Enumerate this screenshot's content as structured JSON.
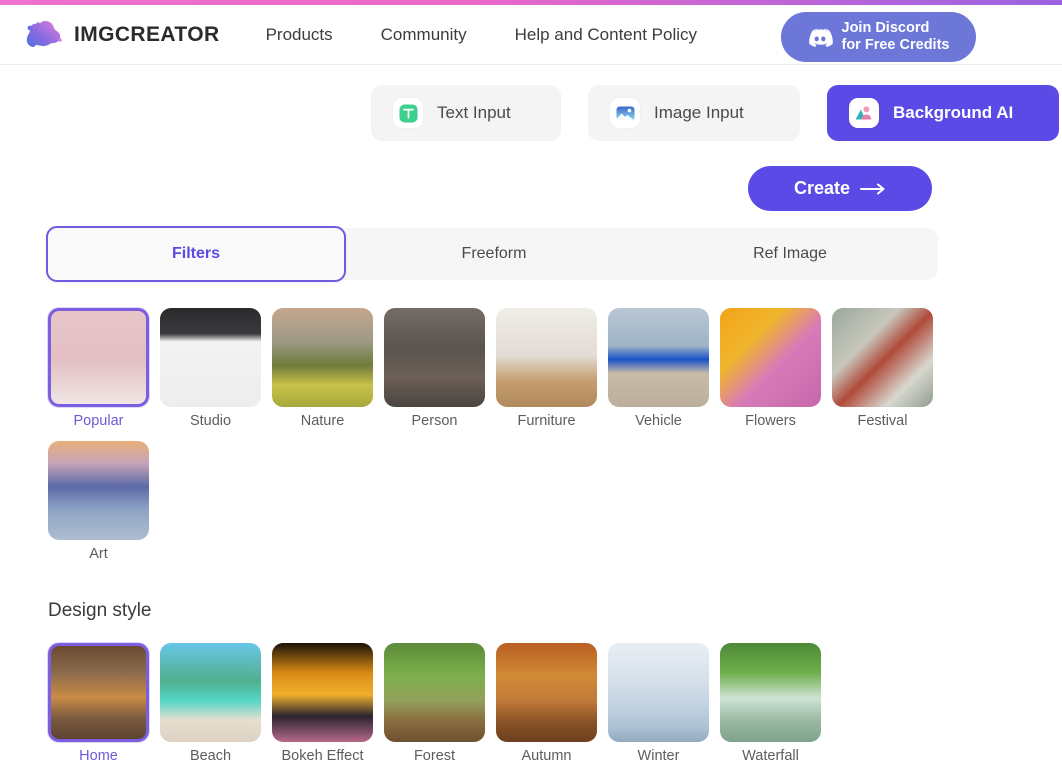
{
  "theme": {
    "accent_purple": "#5b4ae6",
    "accent_purple_border": "#7c5fe0",
    "discord_blue": "#6c77d8",
    "progress_pink": "#ef72cf",
    "panel_gray": "#f4f4f5",
    "text_dark": "#3c3c3c",
    "text_muted": "#5d5d5d"
  },
  "header": {
    "brand": "IMGCREATOR",
    "logo_icon": "blob-cloud-logo-icon",
    "nav": [
      {
        "label": "Products",
        "name": "nav-products"
      },
      {
        "label": "Community",
        "name": "nav-community"
      },
      {
        "label": "Help and Content Policy",
        "name": "nav-help-content-policy"
      }
    ],
    "discord": {
      "label": "Join Discord\nfor Free Credits",
      "icon": "discord-icon"
    }
  },
  "mode_tabs": [
    {
      "label": "Text Input",
      "icon": "text-input-icon",
      "active": false
    },
    {
      "label": "Image Input",
      "icon": "image-input-icon",
      "active": false
    },
    {
      "label": "Background AI",
      "icon": "background-ai-icon",
      "active": true
    }
  ],
  "create_button": {
    "label": "Create",
    "icon": "arrow-right-icon"
  },
  "segmented_tabs": [
    {
      "label": "Filters",
      "active": true
    },
    {
      "label": "Freeform",
      "active": false
    },
    {
      "label": "Ref Image",
      "active": false
    }
  ],
  "filters": {
    "items": [
      {
        "label": "Popular",
        "selected": true,
        "thumb": "woman-in-white-dress-pink-room"
      },
      {
        "label": "Studio",
        "selected": false,
        "thumb": "photo-studio-lighting-setup"
      },
      {
        "label": "Nature",
        "selected": false,
        "thumb": "mountain-meadow-pine-trees"
      },
      {
        "label": "Person",
        "selected": false,
        "thumb": "woman-standing-archway"
      },
      {
        "label": "Furniture",
        "selected": false,
        "thumb": "wooden-table-and-chair"
      },
      {
        "label": "Vehicle",
        "selected": false,
        "thumb": "blue-sedan-on-beach"
      },
      {
        "label": "Flowers",
        "selected": false,
        "thumb": "orange-and-pink-chrysanthemums"
      },
      {
        "label": "Festival",
        "selected": false,
        "thumb": "hands-holding-gift-box"
      },
      {
        "label": "Art",
        "selected": false,
        "thumb": "impressionist-sunrise-painting"
      }
    ]
  },
  "design_style": {
    "title": "Design style",
    "items": [
      {
        "label": "Home",
        "selected": true,
        "thumb": "living-room-with-fireplace"
      },
      {
        "label": "Beach",
        "selected": false,
        "thumb": "palm-trees-turquoise-sea"
      },
      {
        "label": "Bokeh Effect",
        "selected": false,
        "thumb": "orange-bokeh-lights"
      },
      {
        "label": "Forest",
        "selected": false,
        "thumb": "sunbeams-through-forest"
      },
      {
        "label": "Autumn",
        "selected": false,
        "thumb": "autumn-leaves-path"
      },
      {
        "label": "Winter",
        "selected": false,
        "thumb": "snow-drifts-landscape"
      },
      {
        "label": "Waterfall",
        "selected": false,
        "thumb": "waterfall-in-green-forest"
      }
    ]
  }
}
